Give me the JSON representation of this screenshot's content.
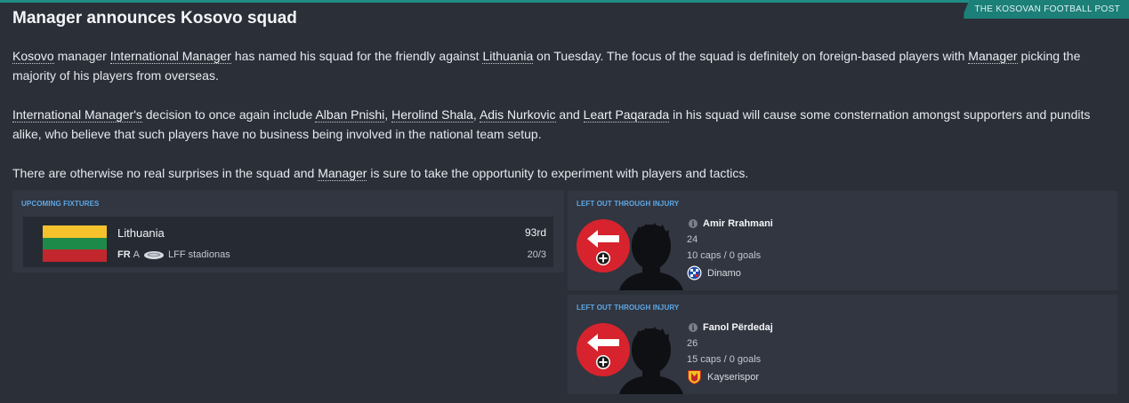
{
  "source": "THE KOSOVAN FOOTBALL POST",
  "headline": "Manager announces Kosovo squad",
  "article": {
    "p1": {
      "t1": "Kosovo",
      "t2": " manager ",
      "t3": "International Manager",
      "t4": " has named his squad for the friendly against ",
      "t5": "Lithuania",
      "t6": " on Tuesday. The focus of the squad is definitely on foreign-based players with ",
      "t7": "Manager",
      "t8": " picking the majority of his players from overseas."
    },
    "p2": {
      "t1": "International Manager's",
      "t2": " decision to once again include ",
      "t3": "Alban Pnishi",
      "t4": ", ",
      "t5": "Herolind Shala",
      "t6": ", ",
      "t7": "Adis Nurkovic",
      "t8": " and ",
      "t9": "Leart Paqarada",
      "t10": " in his squad will cause some consternation amongst supporters and pundits alike, who believe that such players have no business being involved in the national team setup."
    },
    "p3": {
      "t1": "There are otherwise no real surprises in the squad and ",
      "t2": "Manager",
      "t3": " is sure to take the opportunity to experiment with players and tactics."
    }
  },
  "fixtures": {
    "label": "UPCOMING FIXTURES",
    "items": [
      {
        "team": "Lithuania",
        "rank": "93rd",
        "competition": "FR",
        "venue_type": "A",
        "stadium": "LFF stadionas",
        "date": "20/3",
        "flag_colors": [
          "#f5c12c",
          "#1e8a4a",
          "#c1272d"
        ]
      }
    ]
  },
  "injuries": [
    {
      "label": "LEFT OUT THROUGH INJURY",
      "name": "Amir Rrahmani",
      "age": "24",
      "caps": "10 caps / 0 goals",
      "club": "Dinamo"
    },
    {
      "label": "LEFT OUT THROUGH INJURY",
      "name": "Fanol Përdedaj",
      "age": "26",
      "caps": "15 caps / 0 goals",
      "club": "Kayserispor"
    }
  ],
  "icons": {
    "injury": "injury-arrow-icon",
    "info": "info-icon",
    "stadium": "stadium-icon"
  },
  "colors": {
    "background": "#2a2f38",
    "panel": "#313640",
    "accent": "#1f8d86",
    "label_blue": "#5fa8e6",
    "injury_red": "#d7232d"
  }
}
